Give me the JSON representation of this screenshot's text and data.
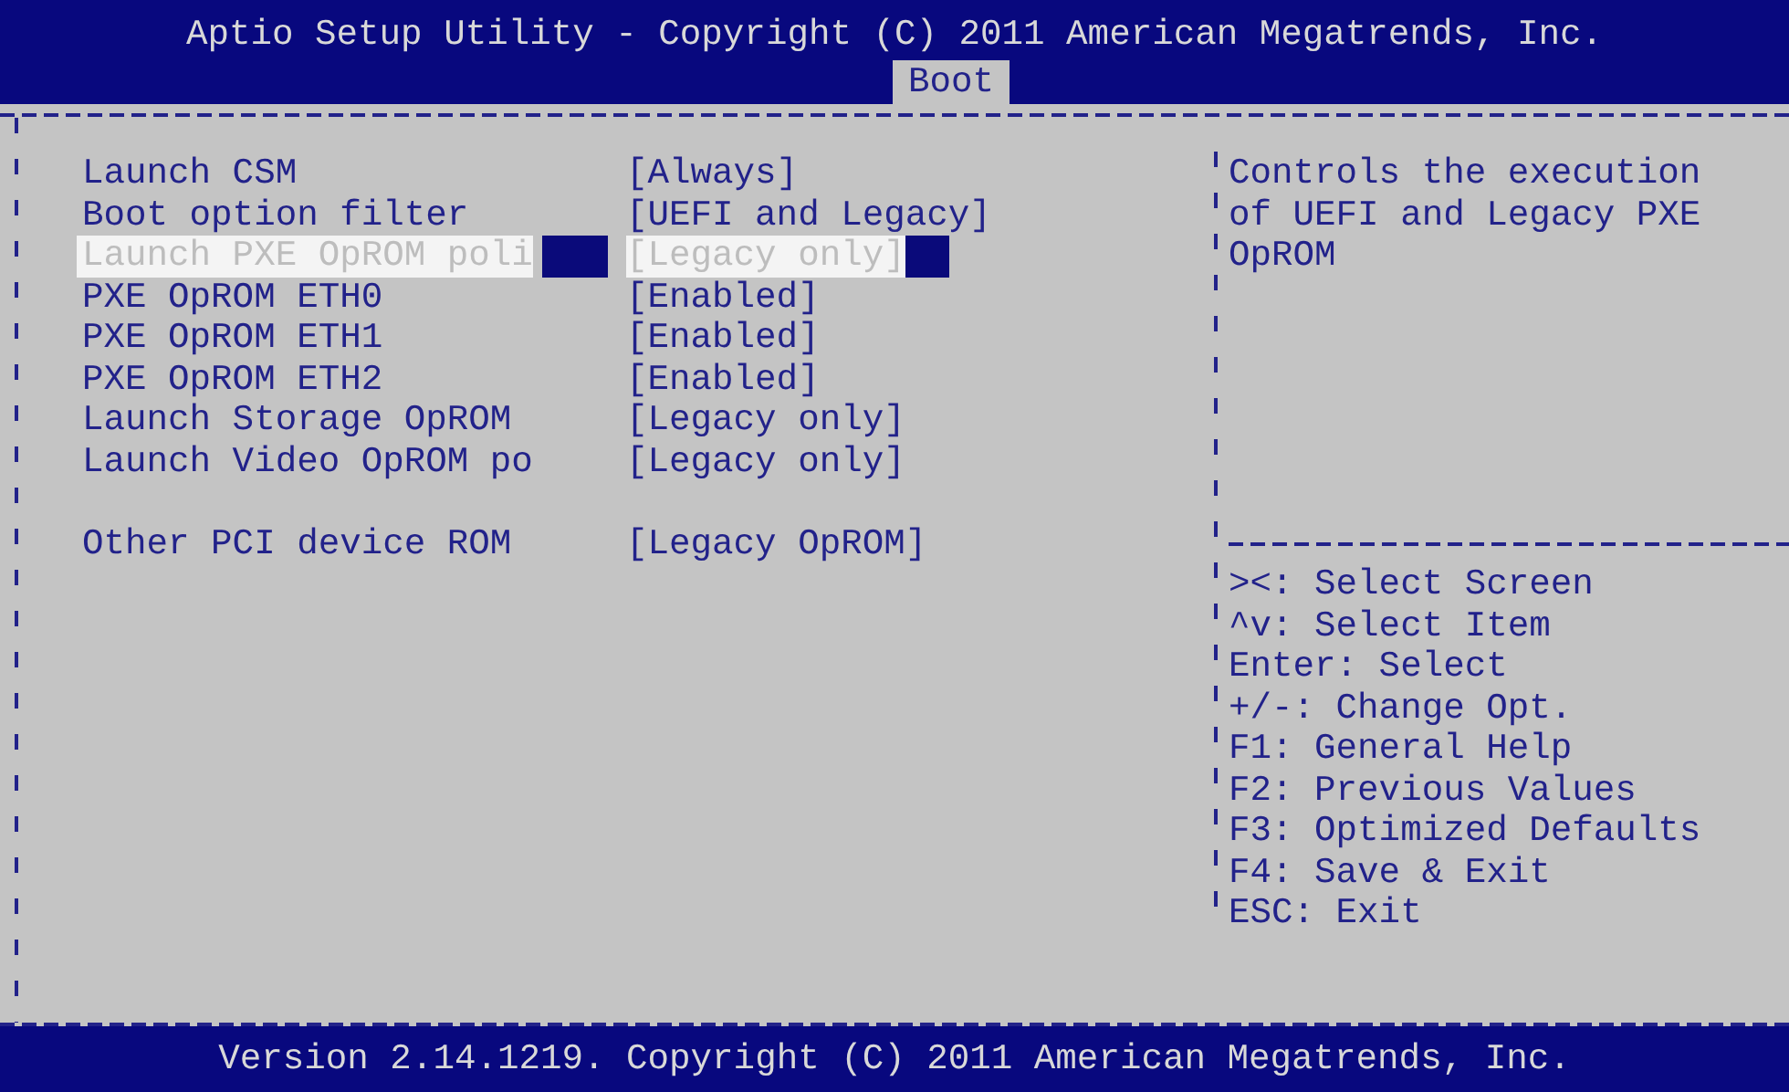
{
  "header": {
    "title": "Aptio Setup Utility - Copyright (C) 2011 American Megatrends, Inc.",
    "tabs": [
      {
        "label": "Boot",
        "selected": true
      }
    ]
  },
  "settings": [
    {
      "kind": "setting",
      "label": "Launch CSM",
      "value": "[Always]",
      "selected": false
    },
    {
      "kind": "setting",
      "label": "Boot option filter",
      "value": "[UEFI and Legacy]",
      "selected": false
    },
    {
      "kind": "setting",
      "label": "Launch PXE OpROM poli",
      "value": "[Legacy only]",
      "selected": true
    },
    {
      "kind": "setting",
      "label": "PXE OpROM ETH0",
      "value": "[Enabled]",
      "selected": false
    },
    {
      "kind": "setting",
      "label": "PXE OpROM ETH1",
      "value": "[Enabled]",
      "selected": false
    },
    {
      "kind": "setting",
      "label": "PXE OpROM ETH2",
      "value": "[Enabled]",
      "selected": false
    },
    {
      "kind": "setting",
      "label": "Launch Storage OpROM",
      "value": "[Legacy only]",
      "selected": false
    },
    {
      "kind": "setting",
      "label": "Launch Video OpROM po",
      "value": "[Legacy only]",
      "selected": false
    },
    {
      "kind": "blank"
    },
    {
      "kind": "setting",
      "label": "Other PCI device ROM",
      "value": "[Legacy OpROM]",
      "selected": false
    }
  ],
  "help": {
    "description": [
      "Controls the execution",
      "of UEFI and Legacy PXE",
      "OpROM"
    ],
    "keys": [
      "><: Select Screen",
      "^v: Select Item",
      "Enter: Select",
      "+/-: Change Opt.",
      "F1: General Help",
      "F2: Previous Values",
      "F3: Optimized Defaults",
      "F4: Save & Exit",
      "ESC: Exit"
    ]
  },
  "footer": "Version 2.14.1219. Copyright (C) 2011 American Megatrends, Inc."
}
